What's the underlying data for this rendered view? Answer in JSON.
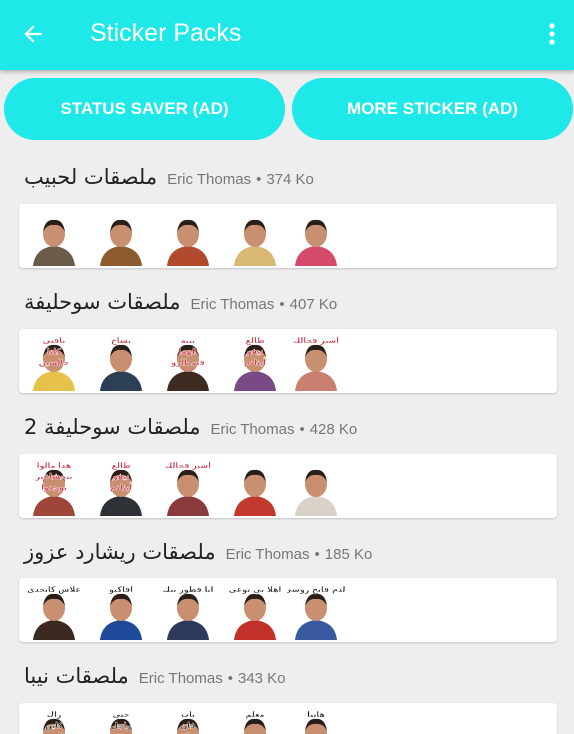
{
  "appbar": {
    "title": "Sticker Packs",
    "back_icon": "arrow-left-icon",
    "menu_icon": "more-vertical-icon"
  },
  "buttons": {
    "status_saver": "STATUS SAVER (AD)",
    "more_sticker": "MORE STICKER (AD)"
  },
  "colors": {
    "accent": "#1ee8e8",
    "card": "#ffffff",
    "background": "#eeeeee"
  },
  "packs": [
    {
      "name": "ملصقات لحبيب",
      "author": "Eric Thomas",
      "size": "374 Ko",
      "stickers": [
        {
          "captions": []
        },
        {
          "captions": []
        },
        {
          "captions": []
        },
        {
          "captions": []
        },
        {
          "captions": []
        }
      ]
    },
    {
      "name": "ملصقات سوحليفة",
      "author": "Eric Thomas",
      "size": "407 Ko",
      "stickers": [
        {
          "captions": [
            "يافتي",
            "كلنا",
            "حالسين"
          ]
        },
        {
          "captions": [
            "بشاخ"
          ]
        },
        {
          "captions": [
            "نيبة",
            "الهما",
            "فصطارو"
          ]
        },
        {
          "captions": [
            "طالع",
            "نيفو",
            "أبنادم"
          ]
        },
        {
          "captions": [
            "أسير فحالك"
          ]
        }
      ]
    },
    {
      "name": "ملصقات سوحليفة 2",
      "author": "Eric Thomas",
      "size": "428 Ko",
      "stickers": [
        {
          "captions": [
            "هدا مالوا",
            "يتحشاغير",
            "بوحدوا"
          ]
        },
        {
          "captions": [
            "طالع",
            "نيفو",
            "أبنادم"
          ]
        },
        {
          "captions": [
            "أسير فحالك"
          ]
        },
        {
          "captions": []
        },
        {
          "captions": []
        }
      ]
    },
    {
      "name": "ملصقات ريشارد عزوز",
      "author": "Eric Thomas",
      "size": "185 Ko",
      "stickers": [
        {
          "captions": [
            "علاش كاتحدي"
          ]
        },
        {
          "captions": [
            "افاكيو"
          ]
        },
        {
          "captions": [
            "انا فطور بيك"
          ]
        },
        {
          "captions": [
            "اهلا بي توعي"
          ]
        },
        {
          "captions": [
            "الدم فاتح روسي"
          ]
        }
      ]
    },
    {
      "name": "ملصقات نيبا",
      "author": "Eric Thomas",
      "size": "343 Ko",
      "stickers": [
        {
          "captions": [
            "راك",
            "كاين",
            "العود"
          ]
        },
        {
          "captions": [
            "حنى",
            "راجل"
          ]
        },
        {
          "captions": [
            "بات",
            "فان",
            "ملك"
          ]
        },
        {
          "captions": [
            "معلم"
          ]
        },
        {
          "captions": [
            "هانيا"
          ]
        }
      ]
    }
  ]
}
